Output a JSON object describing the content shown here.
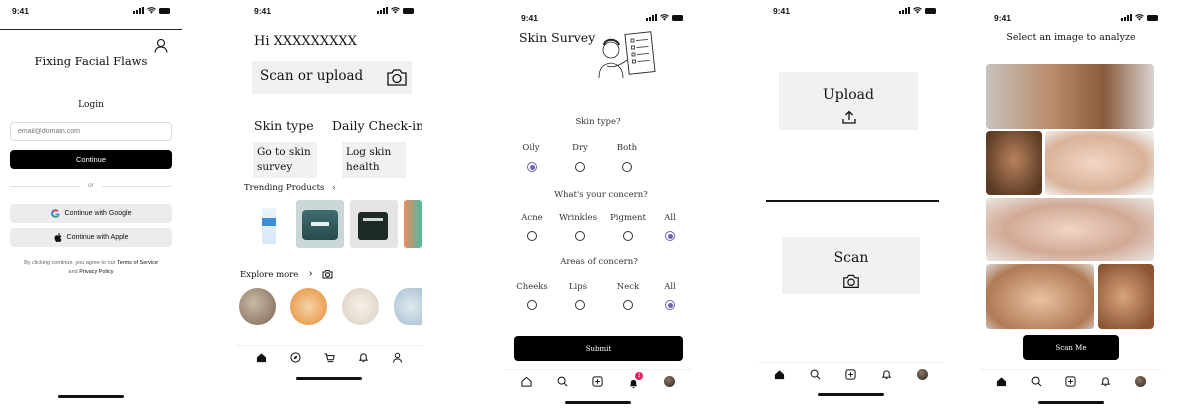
{
  "status_time": "9:41",
  "screen1": {
    "title": "Fixing Facial Flaws",
    "login_label": "Login",
    "email_placeholder": "email@domain.com",
    "continue_label": "Continue",
    "or_label": "or",
    "google_label": "Continue with Google",
    "apple_label": "Continue with Apple",
    "terms_prefix": "By clicking continue, you agree to our",
    "terms_link": "Terms of Service",
    "terms_and": "and",
    "privacy_link": "Privacy Policy"
  },
  "screen2": {
    "greeting": "Hi XXXXXXXXX",
    "scan_label": "Scan or upload",
    "skin_type_heading": "Skin type",
    "checkin_heading": "Daily Check-in",
    "skin_type_button": "Go to skin survey",
    "checkin_button": "Log skin health",
    "trending_label": "Trending Products",
    "explore_label": "Explore more"
  },
  "screen3": {
    "title": "Skin Survey",
    "q1": "Skin type?",
    "q1_options": [
      "Oily",
      "Dry",
      "Both"
    ],
    "q1_selected": 0,
    "q2": "What's your concern?",
    "q2_options": [
      "Acne",
      "Wrinkles",
      "Pigment",
      "All"
    ],
    "q2_selected": 3,
    "q3": "Areas of concern?",
    "q3_options": [
      "Cheeks",
      "Lips",
      "Neck",
      "All"
    ],
    "q3_selected": 3,
    "submit_label": "Submit",
    "notification_count": "1"
  },
  "screen4": {
    "upload_label": "Upload",
    "scan_label": "Scan"
  },
  "screen5": {
    "title": "Select an image to analyze",
    "scan_button": "Scan Me"
  },
  "colors": {
    "accent_radio": "#6b62b8",
    "badge": "#e0245e",
    "card_grey": "#f1f1f1"
  }
}
